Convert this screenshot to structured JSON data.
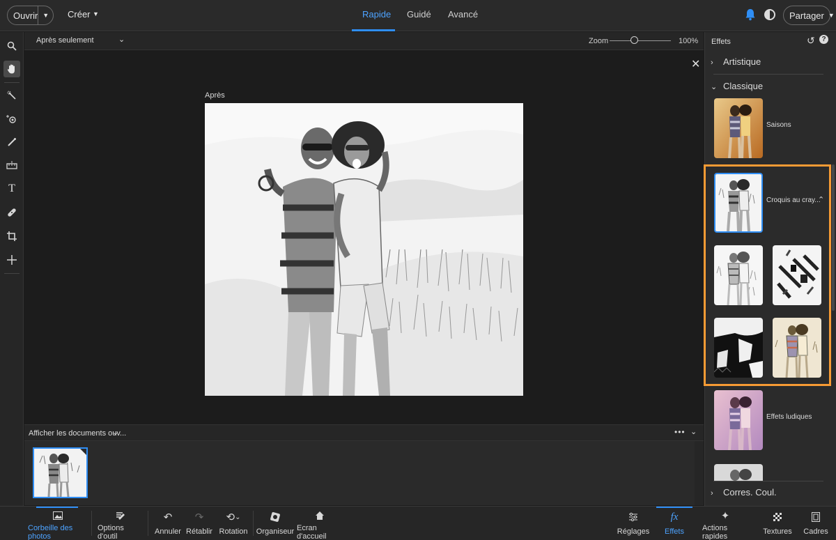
{
  "topbar": {
    "open_label": "Ouvrir",
    "create_label": "Créer",
    "tabs": [
      "Rapide",
      "Guidé",
      "Avancé"
    ],
    "active_tab": "Rapide",
    "share_label": "Partager",
    "accent": "#2f8ef5"
  },
  "viewbar": {
    "view_mode": "Après seulement",
    "zoom_label": "Zoom",
    "zoom_value": "100%",
    "zoom_fraction": 0.4
  },
  "canvas": {
    "after_label": "Après"
  },
  "bin": {
    "selector_label": "Afficher les documents ouv..."
  },
  "effects_panel": {
    "title": "Effets",
    "categories": [
      "Artistique",
      "Classique",
      "Corres. Coul."
    ],
    "effects": {
      "seasons": "Saisons",
      "pencil_sketch": "Croquis au cray...",
      "fun_effects": "Effets ludiques"
    },
    "highlight_color": "#f79b34"
  },
  "bottombar": {
    "items": [
      "Corbeille des photos",
      "Options d'outil",
      "Annuler",
      "Rétablir",
      "Rotation",
      "Organiseur",
      "Ecran d'accueil",
      "Réglages",
      "Effets",
      "Actions rapides",
      "Textures",
      "Cadres"
    ]
  }
}
